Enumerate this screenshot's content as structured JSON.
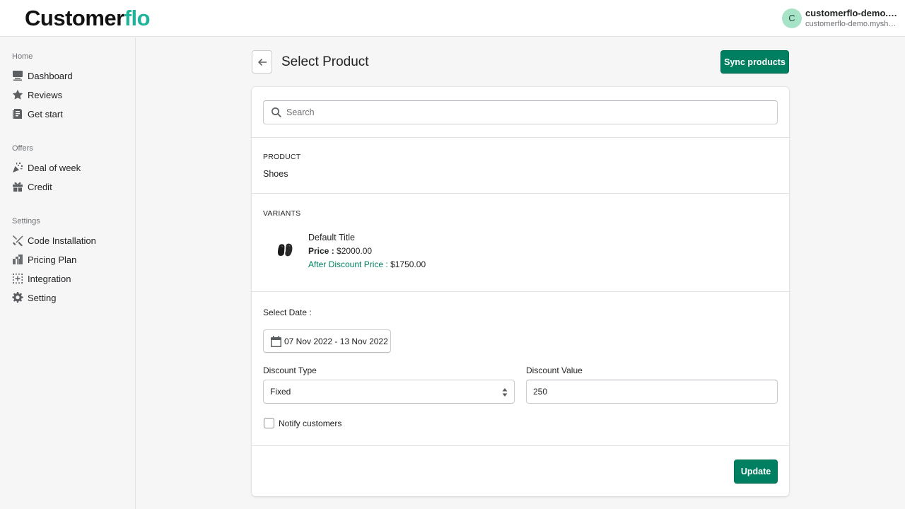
{
  "app": {
    "logo_part1": "Customer",
    "logo_part2": "flo",
    "brand_colors": {
      "logo_dark": "#111111",
      "logo_accent": "#1fb39a",
      "primary": "#008060"
    }
  },
  "user": {
    "initial": "C",
    "name": "customerflo-demo.mys...",
    "shop": "customerflo-demo.myshopif..."
  },
  "sidebar": {
    "sections": [
      {
        "title": "Home",
        "items": [
          {
            "label": "Dashboard",
            "icon": "dashboard-icon"
          },
          {
            "label": "Reviews",
            "icon": "star-icon"
          },
          {
            "label": "Get start",
            "icon": "document-icon"
          }
        ]
      },
      {
        "title": "Offers",
        "items": [
          {
            "label": "Deal of week",
            "icon": "confetti-icon"
          },
          {
            "label": "Credit",
            "icon": "gift-icon"
          }
        ]
      },
      {
        "title": "Settings",
        "items": [
          {
            "label": "Code Installation",
            "icon": "tools-icon"
          },
          {
            "label": "Pricing Plan",
            "icon": "pricing-icon"
          },
          {
            "label": "Integration",
            "icon": "integration-icon"
          },
          {
            "label": "Setting",
            "icon": "gear-icon"
          }
        ]
      }
    ]
  },
  "header": {
    "title": "Select Product",
    "sync_label": "Sync products"
  },
  "search": {
    "placeholder": "Search",
    "value": ""
  },
  "product": {
    "section_label": "PRODUCT",
    "name": "Shoes"
  },
  "variants": {
    "section_label": "VARIANTS",
    "items": [
      {
        "title": "Default Title",
        "price_label": "Price :",
        "price": "$2000.00",
        "discount_label": "After Discount Price :",
        "discount_price": "$1750.00"
      }
    ]
  },
  "form": {
    "date_label": "Select Date :",
    "date_range": "07 Nov 2022 - 13 Nov 2022",
    "discount_type_label": "Discount Type",
    "discount_type_value": "Fixed",
    "discount_value_label": "Discount Value",
    "discount_value": "250",
    "notify_label": "Notify customers",
    "notify_checked": false,
    "update_label": "Update"
  }
}
